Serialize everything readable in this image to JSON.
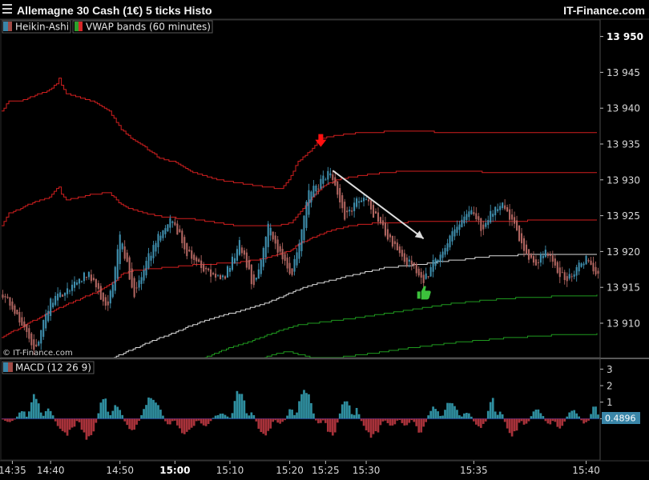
{
  "header": {
    "title": "Allemagne 30 Cash (1€) 5 ticks Histo",
    "brand": "IT-Finance.com"
  },
  "legend": {
    "items": [
      {
        "label": "Heikin-Ashi",
        "colors": [
          "#3a86a8",
          "#a04a45"
        ]
      },
      {
        "label": "VWAP bands (60 minutes)",
        "colors": [
          "#2ca02c",
          "#d62728"
        ]
      }
    ],
    "watermark": "© IT-Finance.com"
  },
  "macd_legend": {
    "label": "MACD (12 26 9)",
    "colors": [
      "#3a86a8",
      "#a04a45"
    ]
  },
  "colors": {
    "background": "#000000",
    "separator": "#3a3a3a",
    "bull": "#3f8fae",
    "bear": "#b06560",
    "upper_band": "#d21f1f",
    "lower_band": "#1f9a1f",
    "vwap": "#dcdcdc",
    "arrow": "#dddddd",
    "sell_marker": "#ff1010",
    "buy_marker": "#3cc23c",
    "macd_value_box": "#3a86a8"
  },
  "chart_data": [
    {
      "type": "line",
      "panel": "price",
      "price_axis": {
        "ylim": [
          13905.2,
          13952.3
        ],
        "ticks": [
          13950,
          13945,
          13940,
          13935,
          13930,
          13925,
          13920,
          13915,
          13910
        ],
        "tick_labels": [
          "13 950",
          "13 945",
          "13 940",
          "13 935",
          "13 930",
          "13 925",
          "13 920",
          "13 915",
          "13 910"
        ]
      },
      "time_axis": {
        "labels": [
          "14:35",
          "14:40",
          "14:50",
          "15:00",
          "15:10",
          "15:20",
          "15:25",
          "15:30",
          "15:35",
          "15:40"
        ],
        "bold": [
          false,
          false,
          false,
          true,
          false,
          false,
          false,
          false,
          false,
          false
        ],
        "tick_index": [
          4,
          20,
          49,
          72,
          95,
          120,
          135,
          152,
          197,
          244
        ]
      },
      "bar_count": 250,
      "price_path_index": [
        0,
        10,
        13,
        20,
        36,
        44,
        49,
        55,
        62,
        70,
        77,
        85,
        92,
        99,
        105,
        111,
        115,
        121,
        128,
        137,
        143,
        151,
        157,
        168,
        176,
        187,
        196,
        200,
        208,
        213,
        222,
        227,
        235,
        244,
        249
      ],
      "price_path_value": [
        13914,
        13909,
        13906,
        13913,
        13917,
        13912,
        13922,
        13914,
        13920,
        13925,
        13920,
        13917,
        13916,
        13921,
        13915,
        13924,
        13920,
        13917,
        13928,
        13931,
        13925,
        13928,
        13924,
        13919,
        13916,
        13922,
        13926,
        13923,
        13927,
        13924,
        13918,
        13920,
        13916,
        13919,
        13917
      ],
      "series": [
        {
          "name": "VWAP",
          "color": "#dcdcdc",
          "x": [
            47,
            55,
            62,
            70,
            78,
            87,
            96,
            105,
            113,
            120,
            126,
            132,
            138,
            144,
            152,
            160,
            168,
            176,
            182,
            187,
            192,
            196,
            200,
            204,
            208,
            216,
            230,
            249
          ],
          "y": [
            13905.2,
            13906.4,
            13907.4,
            13908.4,
            13909.5,
            13910.6,
            13911.4,
            13912.2,
            13913.1,
            13914.1,
            13914.9,
            13915.5,
            13916.0,
            13916.5,
            13917.1,
            13917.7,
            13918.0,
            13918.2,
            13918.5,
            13918.7,
            13918.8,
            13919.0,
            13919.2,
            13919.3,
            13919.4,
            13919.5,
            13919.5,
            13919.5
          ]
        },
        {
          "name": "Upper band 2",
          "color": "#d21f1f",
          "x": [
            0,
            3,
            8,
            14,
            20,
            23,
            24,
            25,
            27,
            32,
            38,
            45,
            50,
            55,
            60,
            66,
            72,
            80,
            90,
            100,
            110,
            117,
            121,
            124,
            130,
            132,
            134,
            140,
            150,
            160,
            170,
            180,
            200,
            220,
            240,
            249
          ],
          "y": [
            13939.5,
            13941.0,
            13941.0,
            13941.8,
            13942.5,
            13943.4,
            13944.1,
            13943.2,
            13942.0,
            13941.5,
            13941.0,
            13939.5,
            13937.0,
            13935.5,
            13934.5,
            13933.0,
            13932.5,
            13931.0,
            13930.0,
            13929.5,
            13929.0,
            13928.8,
            13930.5,
            13932.6,
            13934.3,
            13935.2,
            13935.8,
            13936.2,
            13936.6,
            13936.7,
            13936.7,
            13936.7,
            13936.6,
            13936.6,
            13936.6,
            13936.6
          ]
        },
        {
          "name": "Upper band 1",
          "color": "#d21f1f",
          "x": [
            0,
            3,
            8,
            14,
            20,
            23,
            24,
            25,
            27,
            32,
            38,
            45,
            50,
            55,
            60,
            66,
            72,
            80,
            90,
            100,
            110,
            117,
            121,
            124,
            130,
            134,
            140,
            150,
            160,
            170,
            180,
            200,
            220,
            240,
            249
          ],
          "y": [
            13923.5,
            13925.3,
            13926.0,
            13927.0,
            13927.5,
            13928.8,
            13929.0,
            13928.0,
            13927.2,
            13927.5,
            13928.0,
            13928.2,
            13926.5,
            13925.8,
            13925.3,
            13924.9,
            13924.7,
            13924.5,
            13924.0,
            13923.5,
            13923.5,
            13923.7,
            13924.0,
            13925.2,
            13927.6,
            13929.0,
            13930.0,
            13930.6,
            13931.0,
            13931.2,
            13931.2,
            13931.1,
            13931.0,
            13930.9,
            13930.9
          ]
        },
        {
          "name": "Lower band 1",
          "color": "#d21f1f",
          "x": [
            0,
            10,
            20,
            30,
            40,
            47,
            50,
            55,
            60,
            70,
            80,
            90,
            100,
            110,
            120,
            125,
            130,
            135,
            140,
            145,
            150,
            160,
            170,
            180,
            200,
            220,
            240,
            249
          ],
          "y": [
            13908.0,
            13909.8,
            13911.5,
            13913.0,
            13914.4,
            13915.7,
            13916.8,
            13917.3,
            13917.5,
            13917.8,
            13918.1,
            13918.3,
            13918.5,
            13919.0,
            13920.0,
            13921.2,
            13921.9,
            13922.6,
            13923.1,
            13923.5,
            13923.8,
            13924.0,
            13924.1,
            13924.1,
            13924.2,
            13924.3,
            13924.4,
            13924.4
          ]
        },
        {
          "name": "Lower band 2",
          "color": "#1f9a1f",
          "x": [
            85,
            95,
            105,
            110,
            115,
            120,
            125,
            130,
            140,
            150,
            160,
            170,
            180,
            190,
            200,
            210,
            220,
            230,
            240,
            249
          ],
          "y": [
            13905.2,
            13906.5,
            13907.6,
            13908.2,
            13908.8,
            13909.4,
            13909.8,
            13910.0,
            13910.4,
            13910.8,
            13911.3,
            13911.8,
            13912.3,
            13912.8,
            13913.1,
            13913.4,
            13913.6,
            13913.7,
            13913.8,
            13913.9
          ]
        },
        {
          "name": "Lower band 3",
          "color": "#1f9a1f",
          "x": [
            110,
            115,
            120,
            125,
            130,
            140,
            150,
            160,
            170,
            180,
            190,
            200,
            210,
            220,
            230,
            240,
            249
          ],
          "y": [
            13905.2,
            13905.8,
            13906.0,
            13905.6,
            13905.2,
            13905.2,
            13905.6,
            13906.0,
            13906.5,
            13906.9,
            13907.3,
            13907.6,
            13907.9,
            13908.1,
            13908.3,
            13908.4,
            13908.5
          ]
        }
      ],
      "annotations": [
        {
          "kind": "sell-marker",
          "index": 133,
          "price": 13934.6
        },
        {
          "kind": "trend-arrow",
          "from": {
            "index": 138,
            "price": 13931.3
          },
          "to": {
            "index": 176,
            "price": 13921.8
          }
        },
        {
          "kind": "buy-marker",
          "index": 176,
          "price": 13914.2
        }
      ]
    },
    {
      "type": "bar",
      "panel": "macd",
      "title": "MACD (12 26 9)",
      "ylim": [
        -2.5,
        3.6
      ],
      "ticks": [
        3,
        2,
        1,
        0
      ],
      "tick_labels": [
        "3",
        "2",
        "1",
        "0"
      ],
      "current_value": "0.4896",
      "waves": [
        {
          "start": 0,
          "end": 6,
          "amp": -0.2
        },
        {
          "start": 6,
          "end": 11,
          "amp": 0.5
        },
        {
          "start": 11,
          "end": 17,
          "amp": 1.6
        },
        {
          "start": 17,
          "end": 22,
          "amp": 0.6
        },
        {
          "start": 22,
          "end": 32,
          "amp": -1.0
        },
        {
          "start": 32,
          "end": 40,
          "amp": -1.3
        },
        {
          "start": 40,
          "end": 45,
          "amp": 1.4
        },
        {
          "start": 45,
          "end": 51,
          "amp": 0.8
        },
        {
          "start": 51,
          "end": 58,
          "amp": -0.7
        },
        {
          "start": 58,
          "end": 68,
          "amp": 1.4
        },
        {
          "start": 68,
          "end": 72,
          "amp": -0.4
        },
        {
          "start": 72,
          "end": 82,
          "amp": -0.9
        },
        {
          "start": 82,
          "end": 88,
          "amp": -0.5
        },
        {
          "start": 88,
          "end": 96,
          "amp": 0.3
        },
        {
          "start": 96,
          "end": 103,
          "amp": 1.9
        },
        {
          "start": 103,
          "end": 106,
          "amp": 0.4
        },
        {
          "start": 106,
          "end": 114,
          "amp": -1.0
        },
        {
          "start": 114,
          "end": 119,
          "amp": -0.3
        },
        {
          "start": 119,
          "end": 123,
          "amp": 0.6
        },
        {
          "start": 123,
          "end": 131,
          "amp": 1.9
        },
        {
          "start": 131,
          "end": 135,
          "amp": -0.3
        },
        {
          "start": 135,
          "end": 141,
          "amp": -1.1
        },
        {
          "start": 141,
          "end": 147,
          "amp": 1.2
        },
        {
          "start": 147,
          "end": 150,
          "amp": 0.6
        },
        {
          "start": 150,
          "end": 160,
          "amp": -1.1
        },
        {
          "start": 160,
          "end": 166,
          "amp": -0.5
        },
        {
          "start": 166,
          "end": 172,
          "amp": -0.4
        },
        {
          "start": 172,
          "end": 178,
          "amp": -0.8
        },
        {
          "start": 178,
          "end": 184,
          "amp": 0.8
        },
        {
          "start": 184,
          "end": 192,
          "amp": 1.1
        },
        {
          "start": 192,
          "end": 197,
          "amp": 0.4
        },
        {
          "start": 197,
          "end": 203,
          "amp": -0.6
        },
        {
          "start": 203,
          "end": 207,
          "amp": 1.4
        },
        {
          "start": 207,
          "end": 210,
          "amp": 0.5
        },
        {
          "start": 210,
          "end": 217,
          "amp": -1.1
        },
        {
          "start": 217,
          "end": 221,
          "amp": -0.4
        },
        {
          "start": 221,
          "end": 227,
          "amp": 0.6
        },
        {
          "start": 227,
          "end": 231,
          "amp": -0.4
        },
        {
          "start": 231,
          "end": 236,
          "amp": -0.6
        },
        {
          "start": 236,
          "end": 242,
          "amp": 0.6
        },
        {
          "start": 242,
          "end": 246,
          "amp": -0.3
        },
        {
          "start": 246,
          "end": 250,
          "amp": 0.8
        }
      ]
    }
  ]
}
